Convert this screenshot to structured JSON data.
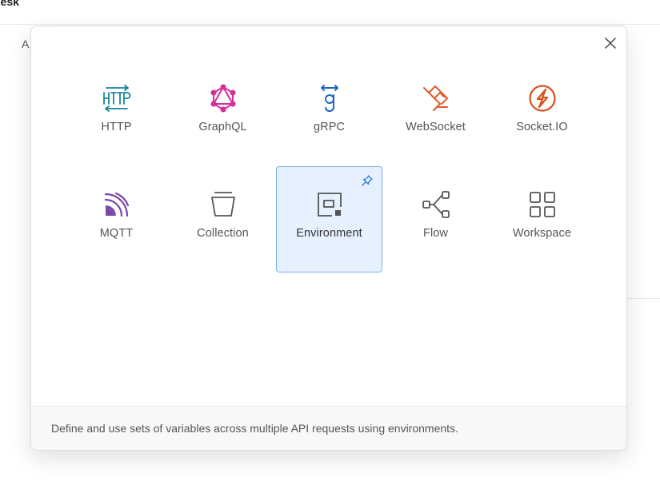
{
  "background": {
    "title": "desk",
    "subtitle": "A"
  },
  "modal": {
    "tiles": [
      {
        "id": "http",
        "label": "HTTP",
        "icon": "http-icon",
        "color": "#17869b"
      },
      {
        "id": "graphql",
        "label": "GraphQL",
        "icon": "graphql-icon",
        "color": "#d62d9a"
      },
      {
        "id": "grpc",
        "label": "gRPC",
        "icon": "grpc-icon",
        "color": "#1e64c8"
      },
      {
        "id": "websocket",
        "label": "WebSocket",
        "icon": "websocket-icon",
        "color": "#e05a2a"
      },
      {
        "id": "socketio",
        "label": "Socket.IO",
        "icon": "socketio-icon",
        "color": "#d9501e"
      },
      {
        "id": "mqtt",
        "label": "MQTT",
        "icon": "mqtt-icon",
        "color": "#7b46a8"
      },
      {
        "id": "collection",
        "label": "Collection",
        "icon": "collection-icon",
        "color": "#555555"
      },
      {
        "id": "environment",
        "label": "Environment",
        "icon": "environment-icon",
        "color": "#555555",
        "selected": true
      },
      {
        "id": "flow",
        "label": "Flow",
        "icon": "flow-icon",
        "color": "#555555"
      },
      {
        "id": "workspace",
        "label": "Workspace",
        "icon": "workspace-icon",
        "color": "#555555"
      }
    ],
    "description": "Define and use sets of variables across multiple API requests using environments.",
    "selected_border_color": "#7fb0f0",
    "selected_bg_color": "#e7f0ff",
    "pin_icon": "pin-icon"
  }
}
